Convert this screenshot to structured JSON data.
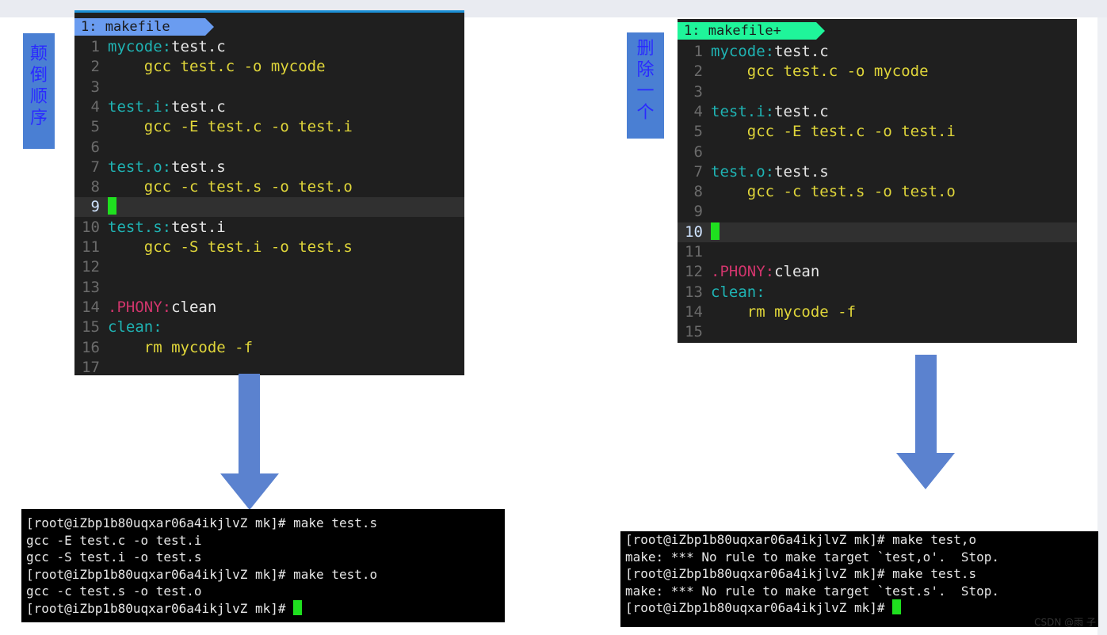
{
  "left": {
    "label_chars": [
      "颠",
      "倒",
      "顺",
      "序"
    ],
    "tab": "1: makefile",
    "tab_color": "#6a9cf0",
    "lines": [
      {
        "n": "1",
        "parts": [
          [
            "cyan",
            "mycode:"
          ],
          [
            "white",
            "test.c"
          ]
        ]
      },
      {
        "n": "2",
        "parts": [
          [
            "yellow",
            "    gcc test.c -o mycode"
          ]
        ]
      },
      {
        "n": "3",
        "parts": []
      },
      {
        "n": "4",
        "parts": [
          [
            "cyan",
            "test.i:"
          ],
          [
            "white",
            "test.c"
          ]
        ]
      },
      {
        "n": "5",
        "parts": [
          [
            "yellow",
            "    gcc -E test.c -o test.i"
          ]
        ]
      },
      {
        "n": "6",
        "parts": []
      },
      {
        "n": "7",
        "parts": [
          [
            "cyan",
            "test.o:"
          ],
          [
            "white",
            "test.s"
          ]
        ]
      },
      {
        "n": "8",
        "parts": [
          [
            "yellow",
            "    gcc -c test.s -o test.o"
          ]
        ]
      },
      {
        "n": "9",
        "parts": [],
        "cursor": true
      },
      {
        "n": "10",
        "parts": [
          [
            "cyan",
            "test.s:"
          ],
          [
            "white",
            "test.i"
          ]
        ]
      },
      {
        "n": "11",
        "parts": [
          [
            "yellow",
            "    gcc -S test.i -o test.s"
          ]
        ]
      },
      {
        "n": "12",
        "parts": []
      },
      {
        "n": "13",
        "parts": []
      },
      {
        "n": "14",
        "parts": [
          [
            "pink",
            ".PHONY:"
          ],
          [
            "white",
            "clean"
          ]
        ]
      },
      {
        "n": "15",
        "parts": [
          [
            "cyan",
            "clean:"
          ]
        ]
      },
      {
        "n": "16",
        "parts": [
          [
            "yellow",
            "    rm mycode -f"
          ]
        ]
      },
      {
        "n": "17",
        "parts": []
      }
    ],
    "terminal": [
      "[root@iZbp1b80uqxar06a4ikjlvZ mk]# make test.s",
      "gcc -E test.c -o test.i",
      "gcc -S test.i -o test.s",
      "[root@iZbp1b80uqxar06a4ikjlvZ mk]# make test.o",
      "gcc -c test.s -o test.o",
      "[root@iZbp1b80uqxar06a4ikjlvZ mk]# "
    ]
  },
  "right": {
    "label_chars": [
      "删",
      "除",
      "一",
      "个"
    ],
    "tab": "1: makefile+",
    "tab_color": "#1ff59a",
    "lines": [
      {
        "n": "1",
        "parts": [
          [
            "cyan",
            "mycode:"
          ],
          [
            "white",
            "test.c"
          ]
        ]
      },
      {
        "n": "2",
        "parts": [
          [
            "yellow",
            "    gcc test.c -o mycode"
          ]
        ]
      },
      {
        "n": "3",
        "parts": []
      },
      {
        "n": "4",
        "parts": [
          [
            "cyan",
            "test.i:"
          ],
          [
            "white",
            "test.c"
          ]
        ]
      },
      {
        "n": "5",
        "parts": [
          [
            "yellow",
            "    gcc -E test.c -o test.i"
          ]
        ]
      },
      {
        "n": "6",
        "parts": []
      },
      {
        "n": "7",
        "parts": [
          [
            "cyan",
            "test.o:"
          ],
          [
            "white",
            "test.s"
          ]
        ]
      },
      {
        "n": "8",
        "parts": [
          [
            "yellow",
            "    gcc -c test.s -o test.o"
          ]
        ]
      },
      {
        "n": "9",
        "parts": []
      },
      {
        "n": "10",
        "parts": [],
        "cursor": true
      },
      {
        "n": "11",
        "parts": []
      },
      {
        "n": "12",
        "parts": [
          [
            "pink",
            ".PHONY:"
          ],
          [
            "white",
            "clean"
          ]
        ]
      },
      {
        "n": "13",
        "parts": [
          [
            "cyan",
            "clean:"
          ]
        ]
      },
      {
        "n": "14",
        "parts": [
          [
            "yellow",
            "    rm mycode -f"
          ]
        ]
      },
      {
        "n": "15",
        "parts": []
      }
    ],
    "terminal": [
      "[root@iZbp1b80uqxar06a4ikjlvZ mk]# make test,o",
      "make: *** No rule to make target `test,o'.  Stop.",
      "[root@iZbp1b80uqxar06a4ikjlvZ mk]# make test.s",
      "make: *** No rule to make target `test.s'.  Stop.",
      "[root@iZbp1b80uqxar06a4ikjlvZ mk]# "
    ]
  },
  "colors": {
    "arrow": "#5b82cf",
    "cursor": "#1fe01f",
    "editor_bg": "#1f1f1f"
  },
  "watermark": "CSDN @雨 子"
}
